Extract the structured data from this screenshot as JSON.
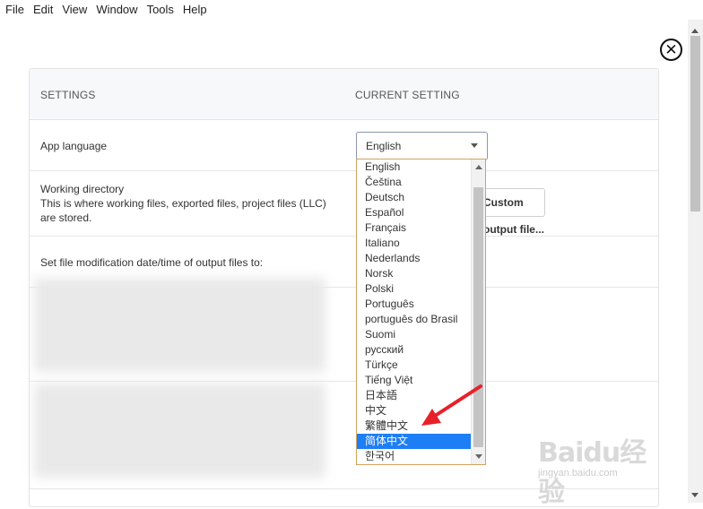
{
  "menu": [
    "File",
    "Edit",
    "View",
    "Window",
    "Tools",
    "Help"
  ],
  "settings": {
    "header": {
      "settings": "SETTINGS",
      "current": "CURRENT SETTING"
    },
    "language": {
      "label": "App language",
      "value": "English"
    },
    "working_dir": {
      "label_line1": "Working directory",
      "label_line2": "This is where working files, exported files, project files (LLC)",
      "label_line3": "are stored.",
      "button": "Custom output file..."
    },
    "modification": {
      "label": "Set file modification date/time of output files to:"
    }
  },
  "dropdown": {
    "options": [
      "English",
      "Čeština",
      "Deutsch",
      "Español",
      "Français",
      "Italiano",
      "Nederlands",
      "Norsk",
      "Polski",
      "Português",
      "português do Brasil",
      "Suomi",
      "русский",
      "Türkçe",
      "Tiếng Việt",
      "日本語",
      "中文",
      "繁體中文",
      "简体中文",
      "한국어"
    ],
    "highlighted": "简体中文"
  },
  "watermark": {
    "brand": "Baidu经验",
    "url": "jingyan.baidu.com"
  },
  "colors": {
    "highlight": "#1e7ef5",
    "arrow": "#e8202a",
    "select_border": "#8b95b4",
    "dropdown_border": "#d3a35a"
  }
}
